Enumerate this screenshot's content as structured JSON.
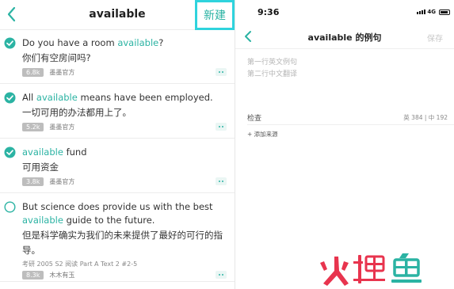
{
  "left": {
    "title": "available",
    "new_button": "新建",
    "examples": [
      {
        "checked": true,
        "en_before": "Do you have a room ",
        "en_highlight": "available",
        "en_after": "?",
        "zh": "你们有空房间吗?",
        "count": "6.8k",
        "source": "墨墨官方",
        "reference": ""
      },
      {
        "checked": true,
        "en_before": "All ",
        "en_highlight": "available",
        "en_after": " means have been employed.",
        "zh": "一切可用的办法都用上了。",
        "count": "5.2k",
        "source": "墨墨官方",
        "reference": ""
      },
      {
        "checked": true,
        "en_before": "",
        "en_highlight": "available",
        "en_after": " fund",
        "zh": "可用资金",
        "count": "3.8k",
        "source": "墨墨官方",
        "reference": ""
      },
      {
        "checked": false,
        "en_before": "But science does provide us with the best ",
        "en_highlight": "available",
        "en_after": " guide to the future.",
        "zh": "但是科学确实为我们的未来提供了最好的可行的指导。",
        "count": "8.3k",
        "source": "木木有玉",
        "reference": "考研 2005 S2 阅读 Part A Text 2 #2-5"
      }
    ]
  },
  "right": {
    "status_time": "9:36",
    "network": "4G",
    "title": "available 的例句",
    "save": "保存",
    "placeholder_line1": "第一行英文例句",
    "placeholder_line2": "第二行中文翻译",
    "check_label": "检查",
    "check_stats": "英 384 | 中 192",
    "add_source": "+ 添加来源"
  },
  "watermark": "火鲤鱼",
  "colors": {
    "accent": "#2bb3a3",
    "highlight_box": "#2fd3dd",
    "watermark": "#e8344e"
  }
}
